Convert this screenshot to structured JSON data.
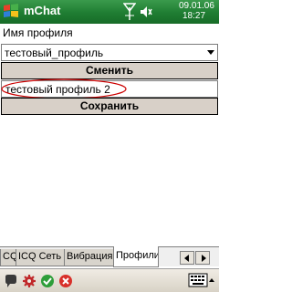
{
  "titlebar": {
    "app_title": "mChat",
    "date": "09.01.06",
    "time": "18:27",
    "start_icon": "windows-flag-icon",
    "signal_icon": "signal-icon",
    "volume_icon": "volume-mute-icon"
  },
  "form": {
    "profile_label": "Имя профиля",
    "selected_profile": "тестовый_профиль",
    "change_button": "Сменить",
    "profile_name_value": "тестовый профиль 2",
    "save_button": "Сохранить"
  },
  "tabs": [
    {
      "label": "CQ"
    },
    {
      "label": "ICQ Сеть"
    },
    {
      "label": "Вибрация"
    },
    {
      "label": "Профили",
      "active": true
    }
  ],
  "menubar": {
    "icons": [
      "status-icon",
      "settings-icon",
      "ok-icon",
      "close-icon",
      "keyboard-icon"
    ]
  },
  "colors": {
    "titlebar": "#1f7d32",
    "button_face": "#d8d0c8",
    "annotation": "#cc0000"
  }
}
